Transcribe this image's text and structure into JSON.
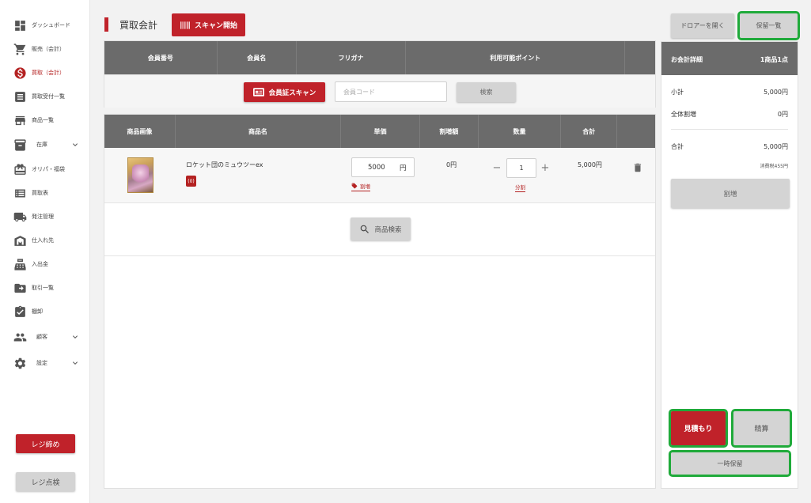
{
  "sidebar": {
    "items": [
      {
        "label": "ダッシュボード",
        "icon": "dashboard-icon"
      },
      {
        "label": "販売（会計）",
        "icon": "cart-icon"
      },
      {
        "label": "買取（会計）",
        "icon": "dollar-icon"
      },
      {
        "label": "買取受付一覧",
        "icon": "receipt-icon"
      },
      {
        "label": "商品一覧",
        "icon": "store-icon"
      },
      {
        "label": "在庫",
        "icon": "inventory-icon"
      },
      {
        "label": "オリパ・福袋",
        "icon": "gift-icon"
      },
      {
        "label": "買取表",
        "icon": "list-icon"
      },
      {
        "label": "発注管理",
        "icon": "truck-icon"
      },
      {
        "label": "仕入れ先",
        "icon": "warehouse-icon"
      },
      {
        "label": "入出金",
        "icon": "register-icon"
      },
      {
        "label": "取引一覧",
        "icon": "folder-icon"
      },
      {
        "label": "棚卸",
        "icon": "clipboard-check-icon"
      },
      {
        "label": "顧客",
        "icon": "people-icon"
      },
      {
        "label": "設定",
        "icon": "gear-icon"
      }
    ],
    "close_register": "レジ締め",
    "check_register": "レジ点検"
  },
  "header": {
    "title": "買取会計",
    "scan_start": "スキャン開始",
    "open_drawer": "ドロアーを開く",
    "hold_list": "保留一覧"
  },
  "member": {
    "columns": [
      "会員番号",
      "会員名",
      "フリガナ",
      "利用可能ポイント"
    ],
    "card_scan": "会員証スキャン",
    "code_placeholder": "会員コード",
    "search": "検索"
  },
  "items": {
    "columns": [
      "商品画像",
      "商品名",
      "単価",
      "割増額",
      "数量",
      "合計"
    ],
    "rows": [
      {
        "name": "ロケット団のミュウツーex",
        "badge": "(0)",
        "unit_price": "5000",
        "unit": "円",
        "markup_link": "割増",
        "markup_amount": "0円",
        "quantity": "1",
        "split_link": "分割",
        "total": "5,000円"
      }
    ],
    "product_search": "商品検索"
  },
  "summary": {
    "title": "お会計詳細",
    "count": "1商品1点",
    "subtotal_label": "小計",
    "subtotal_value": "5,000円",
    "overall_markup_label": "全体割増",
    "overall_markup_value": "0円",
    "total_label": "合計",
    "total_value": "5,000円",
    "tax_note": "消費税455円",
    "markup_button": "割増",
    "estimate": "見積もり",
    "settle": "精算",
    "temp_hold": "一時保留"
  },
  "colors": {
    "accent": "#c0222a",
    "highlight": "#1faa3a",
    "header_gray": "#6b6b6b"
  }
}
